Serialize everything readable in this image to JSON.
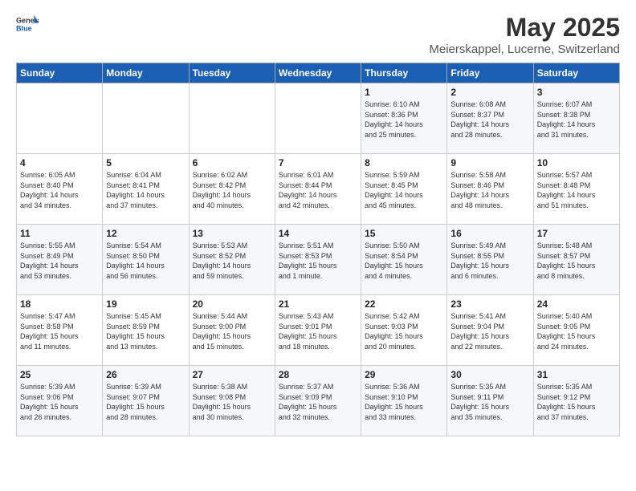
{
  "header": {
    "logo_general": "General",
    "logo_blue": "Blue",
    "title": "May 2025",
    "subtitle": "Meierskappel, Lucerne, Switzerland"
  },
  "days_of_week": [
    "Sunday",
    "Monday",
    "Tuesday",
    "Wednesday",
    "Thursday",
    "Friday",
    "Saturday"
  ],
  "weeks": [
    [
      {
        "day": "",
        "info": ""
      },
      {
        "day": "",
        "info": ""
      },
      {
        "day": "",
        "info": ""
      },
      {
        "day": "",
        "info": ""
      },
      {
        "day": "1",
        "info": "Sunrise: 6:10 AM\nSunset: 8:36 PM\nDaylight: 14 hours\nand 25 minutes."
      },
      {
        "day": "2",
        "info": "Sunrise: 6:08 AM\nSunset: 8:37 PM\nDaylight: 14 hours\nand 28 minutes."
      },
      {
        "day": "3",
        "info": "Sunrise: 6:07 AM\nSunset: 8:38 PM\nDaylight: 14 hours\nand 31 minutes."
      }
    ],
    [
      {
        "day": "4",
        "info": "Sunrise: 6:05 AM\nSunset: 8:40 PM\nDaylight: 14 hours\nand 34 minutes."
      },
      {
        "day": "5",
        "info": "Sunrise: 6:04 AM\nSunset: 8:41 PM\nDaylight: 14 hours\nand 37 minutes."
      },
      {
        "day": "6",
        "info": "Sunrise: 6:02 AM\nSunset: 8:42 PM\nDaylight: 14 hours\nand 40 minutes."
      },
      {
        "day": "7",
        "info": "Sunrise: 6:01 AM\nSunset: 8:44 PM\nDaylight: 14 hours\nand 42 minutes."
      },
      {
        "day": "8",
        "info": "Sunrise: 5:59 AM\nSunset: 8:45 PM\nDaylight: 14 hours\nand 45 minutes."
      },
      {
        "day": "9",
        "info": "Sunrise: 5:58 AM\nSunset: 8:46 PM\nDaylight: 14 hours\nand 48 minutes."
      },
      {
        "day": "10",
        "info": "Sunrise: 5:57 AM\nSunset: 8:48 PM\nDaylight: 14 hours\nand 51 minutes."
      }
    ],
    [
      {
        "day": "11",
        "info": "Sunrise: 5:55 AM\nSunset: 8:49 PM\nDaylight: 14 hours\nand 53 minutes."
      },
      {
        "day": "12",
        "info": "Sunrise: 5:54 AM\nSunset: 8:50 PM\nDaylight: 14 hours\nand 56 minutes."
      },
      {
        "day": "13",
        "info": "Sunrise: 5:53 AM\nSunset: 8:52 PM\nDaylight: 14 hours\nand 59 minutes."
      },
      {
        "day": "14",
        "info": "Sunrise: 5:51 AM\nSunset: 8:53 PM\nDaylight: 15 hours\nand 1 minute."
      },
      {
        "day": "15",
        "info": "Sunrise: 5:50 AM\nSunset: 8:54 PM\nDaylight: 15 hours\nand 4 minutes."
      },
      {
        "day": "16",
        "info": "Sunrise: 5:49 AM\nSunset: 8:55 PM\nDaylight: 15 hours\nand 6 minutes."
      },
      {
        "day": "17",
        "info": "Sunrise: 5:48 AM\nSunset: 8:57 PM\nDaylight: 15 hours\nand 8 minutes."
      }
    ],
    [
      {
        "day": "18",
        "info": "Sunrise: 5:47 AM\nSunset: 8:58 PM\nDaylight: 15 hours\nand 11 minutes."
      },
      {
        "day": "19",
        "info": "Sunrise: 5:45 AM\nSunset: 8:59 PM\nDaylight: 15 hours\nand 13 minutes."
      },
      {
        "day": "20",
        "info": "Sunrise: 5:44 AM\nSunset: 9:00 PM\nDaylight: 15 hours\nand 15 minutes."
      },
      {
        "day": "21",
        "info": "Sunrise: 5:43 AM\nSunset: 9:01 PM\nDaylight: 15 hours\nand 18 minutes."
      },
      {
        "day": "22",
        "info": "Sunrise: 5:42 AM\nSunset: 9:03 PM\nDaylight: 15 hours\nand 20 minutes."
      },
      {
        "day": "23",
        "info": "Sunrise: 5:41 AM\nSunset: 9:04 PM\nDaylight: 15 hours\nand 22 minutes."
      },
      {
        "day": "24",
        "info": "Sunrise: 5:40 AM\nSunset: 9:05 PM\nDaylight: 15 hours\nand 24 minutes."
      }
    ],
    [
      {
        "day": "25",
        "info": "Sunrise: 5:39 AM\nSunset: 9:06 PM\nDaylight: 15 hours\nand 26 minutes."
      },
      {
        "day": "26",
        "info": "Sunrise: 5:39 AM\nSunset: 9:07 PM\nDaylight: 15 hours\nand 28 minutes."
      },
      {
        "day": "27",
        "info": "Sunrise: 5:38 AM\nSunset: 9:08 PM\nDaylight: 15 hours\nand 30 minutes."
      },
      {
        "day": "28",
        "info": "Sunrise: 5:37 AM\nSunset: 9:09 PM\nDaylight: 15 hours\nand 32 minutes."
      },
      {
        "day": "29",
        "info": "Sunrise: 5:36 AM\nSunset: 9:10 PM\nDaylight: 15 hours\nand 33 minutes."
      },
      {
        "day": "30",
        "info": "Sunrise: 5:35 AM\nSunset: 9:11 PM\nDaylight: 15 hours\nand 35 minutes."
      },
      {
        "day": "31",
        "info": "Sunrise: 5:35 AM\nSunset: 9:12 PM\nDaylight: 15 hours\nand 37 minutes."
      }
    ]
  ]
}
